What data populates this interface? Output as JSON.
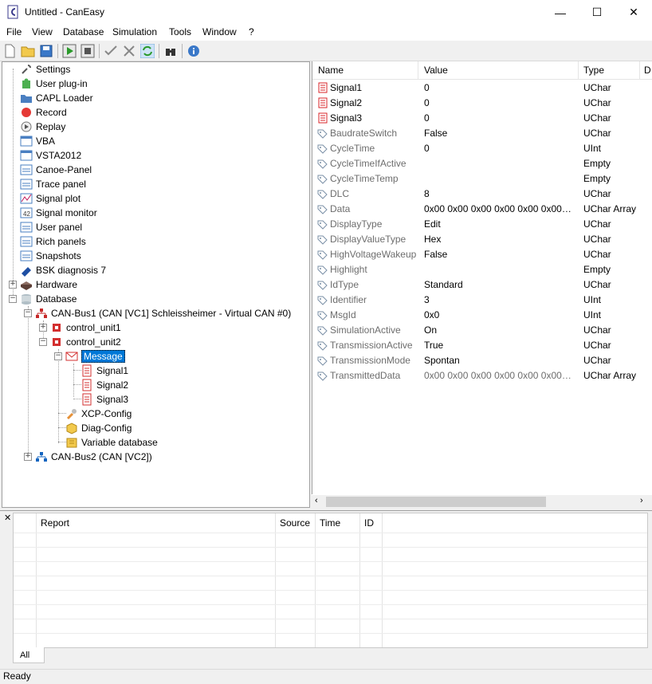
{
  "window": {
    "title": "Untitled - CanEasy",
    "minimize": "—",
    "maximize": "☐",
    "close": "✕"
  },
  "menu": [
    "File",
    "View",
    "Database",
    "Simulation",
    "Tools",
    "Window",
    "?"
  ],
  "toolbar": [
    "new-icon",
    "open-icon",
    "save-icon",
    "start-icon",
    "stop-icon",
    "check-icon",
    "uncheck-icon",
    "refresh-icon",
    "find-icon",
    "info-icon"
  ],
  "tree": [
    {
      "label": "Settings",
      "icon": "wrench-icon"
    },
    {
      "label": "User plug-in",
      "icon": "puzzle-icon"
    },
    {
      "label": "CAPL Loader",
      "icon": "folder-icon"
    },
    {
      "label": "Record",
      "icon": "record-icon"
    },
    {
      "label": "Replay",
      "icon": "replay-icon"
    },
    {
      "label": "VBA",
      "icon": "window-icon"
    },
    {
      "label": "VSTA2012",
      "icon": "window-icon"
    },
    {
      "label": "Canoe-Panel",
      "icon": "panel-icon"
    },
    {
      "label": "Trace panel",
      "icon": "panel-icon"
    },
    {
      "label": "Signal plot",
      "icon": "plot-icon"
    },
    {
      "label": "Signal monitor",
      "icon": "monitor-icon"
    },
    {
      "label": "User panel",
      "icon": "panel-icon"
    },
    {
      "label": "Rich panels",
      "icon": "panel-icon"
    },
    {
      "label": "Snapshots",
      "icon": "panel-icon"
    },
    {
      "label": "BSK diagnosis 7",
      "icon": "diag-icon"
    },
    {
      "label": "Hardware",
      "icon": "hardware-icon"
    },
    {
      "label": "Database",
      "icon": "database-icon"
    },
    {
      "label": "CAN-Bus1 (CAN [VC1] Schleissheimer - Virtual CAN #0)",
      "icon": "bus-icon"
    },
    {
      "label": "control_unit1",
      "icon": "ecu-icon"
    },
    {
      "label": "control_unit2",
      "icon": "ecu-icon"
    },
    {
      "label": "Message",
      "icon": "message-icon"
    },
    {
      "label": "Signal1",
      "icon": "signal-icon"
    },
    {
      "label": "Signal2",
      "icon": "signal-icon"
    },
    {
      "label": "Signal3",
      "icon": "signal-icon"
    },
    {
      "label": "XCP-Config",
      "icon": "tool-icon"
    },
    {
      "label": "Diag-Config",
      "icon": "box-icon"
    },
    {
      "label": "Variable database",
      "icon": "vardb-icon"
    },
    {
      "label": "CAN-Bus2 (CAN [VC2])",
      "icon": "bus-icon"
    }
  ],
  "props": {
    "headers": {
      "name": "Name",
      "value": "Value",
      "type": "Type",
      "extra": "D"
    },
    "rows": [
      {
        "name": "Signal1",
        "value": "0",
        "type": "UChar",
        "kind": "signal"
      },
      {
        "name": "Signal2",
        "value": "0",
        "type": "UChar",
        "kind": "signal"
      },
      {
        "name": "Signal3",
        "value": "0",
        "type": "UChar",
        "kind": "signal"
      },
      {
        "name": "BaudrateSwitch",
        "value": "False",
        "type": "UChar",
        "kind": "tag"
      },
      {
        "name": "CycleTime",
        "value": "0",
        "type": "UInt",
        "kind": "tag"
      },
      {
        "name": "CycleTimeIfActive",
        "value": "",
        "type": "Empty",
        "kind": "tag"
      },
      {
        "name": "CycleTimeTemp",
        "value": "",
        "type": "Empty",
        "kind": "tag"
      },
      {
        "name": "DLC",
        "value": "8",
        "type": "UChar",
        "kind": "tag"
      },
      {
        "name": "Data",
        "value": "0x00 0x00 0x00 0x00 0x00 0x00 0x00...",
        "type": "UChar Array",
        "kind": "tag"
      },
      {
        "name": "DisplayType",
        "value": "Edit",
        "type": "UChar",
        "kind": "tag"
      },
      {
        "name": "DisplayValueType",
        "value": "Hex",
        "type": "UChar",
        "kind": "tag"
      },
      {
        "name": "HighVoltageWakeup",
        "value": "False",
        "type": "UChar",
        "kind": "tag"
      },
      {
        "name": "Highlight",
        "value": "",
        "type": "Empty",
        "kind": "tag"
      },
      {
        "name": "IdType",
        "value": "Standard",
        "type": "UChar",
        "kind": "tag"
      },
      {
        "name": "Identifier",
        "value": "3",
        "type": "UInt",
        "kind": "tag"
      },
      {
        "name": "MsgId",
        "value": "0x0",
        "type": "UInt",
        "kind": "tag"
      },
      {
        "name": "SimulationActive",
        "value": "On",
        "type": "UChar",
        "kind": "tag"
      },
      {
        "name": "TransmissionActive",
        "value": "True",
        "type": "UChar",
        "kind": "tag"
      },
      {
        "name": "TransmissionMode",
        "value": "Spontan",
        "type": "UChar",
        "kind": "tag"
      },
      {
        "name": "TransmittedData",
        "value": "0x00 0x00 0x00 0x00 0x00 0x00 0x00...",
        "type": "UChar Array",
        "kind": "tag",
        "greyvalue": true
      }
    ]
  },
  "report": {
    "headers": [
      "Report",
      "Source",
      "Time",
      "ID"
    ],
    "tab": "All"
  },
  "status": "Ready",
  "colors": {
    "selection": "#0078d7",
    "signal": "#d9252a",
    "tag": "#7a8fa6"
  }
}
